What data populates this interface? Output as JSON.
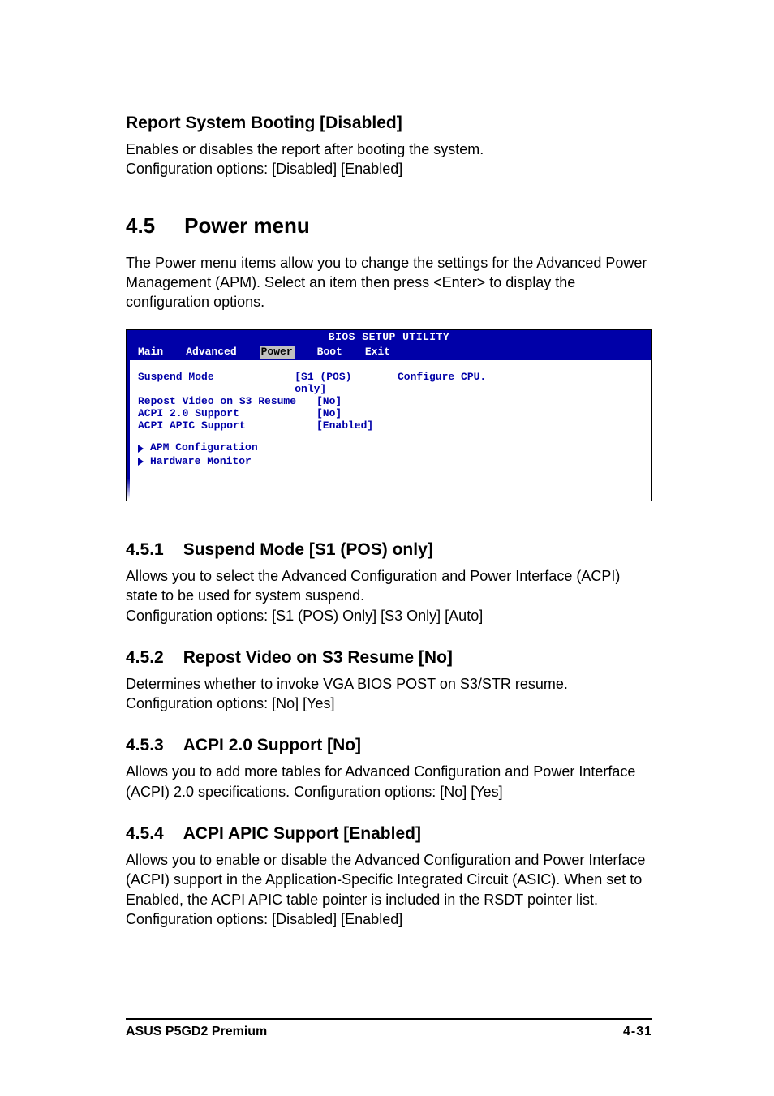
{
  "section_rsb": {
    "heading": "Report System Booting [Disabled]",
    "p1": "Enables or disables the report after booting the system.",
    "p2": "Configuration options: [Disabled] [Enabled]"
  },
  "sec45": {
    "num": "4.5",
    "title": "Power menu",
    "intro": "The Power menu items allow you to change the settings for the Advanced Power Management (APM). Select an item then press <Enter> to display the configuration options."
  },
  "bios": {
    "title": "BIOS SETUP UTILITY",
    "tabs": [
      "Main",
      "Advanced",
      "Power",
      "Boot",
      "Exit"
    ],
    "selected_tab": "Power",
    "rows": [
      {
        "label": "Suspend Mode",
        "value": "[S1 (POS) only]"
      },
      {
        "label": "Repost Video on S3 Resume",
        "value": "[No]"
      },
      {
        "label": "ACPI 2.0 Support",
        "value": "[No]"
      },
      {
        "label": "ACPI APIC Support",
        "value": "[Enabled]"
      }
    ],
    "submenus": [
      "APM Configuration",
      "Hardware Monitor"
    ],
    "help": "Configure CPU."
  },
  "s451": {
    "num": "4.5.1",
    "title": "Suspend Mode [S1 (POS) only]",
    "p1": "Allows you to select the Advanced Configuration and Power Interface (ACPI) state to be used for system suspend.",
    "p2": "Configuration options: [S1 (POS) Only] [S3 Only] [Auto]"
  },
  "s452": {
    "num": "4.5.2",
    "title": "Repost Video on S3 Resume [No]",
    "p1": "Determines whether to invoke VGA BIOS POST on S3/STR resume. Configuration options: [No] [Yes]"
  },
  "s453": {
    "num": "4.5.3",
    "title": "ACPI 2.0 Support [No]",
    "p1": "Allows you to add more tables for Advanced Configuration and Power Interface (ACPI) 2.0 specifications. Configuration options: [No] [Yes]"
  },
  "s454": {
    "num": "4.5.4",
    "title": "ACPI APIC Support [Enabled]",
    "p1": "Allows you to enable or disable the Advanced Configuration and Power Interface (ACPI) support in the Application-Specific Integrated Circuit (ASIC). When set to Enabled, the ACPI APIC table pointer is included in the RSDT pointer list. Configuration options: [Disabled] [Enabled]"
  },
  "footer": {
    "left": "ASUS P5GD2 Premium",
    "right": "4-31"
  }
}
